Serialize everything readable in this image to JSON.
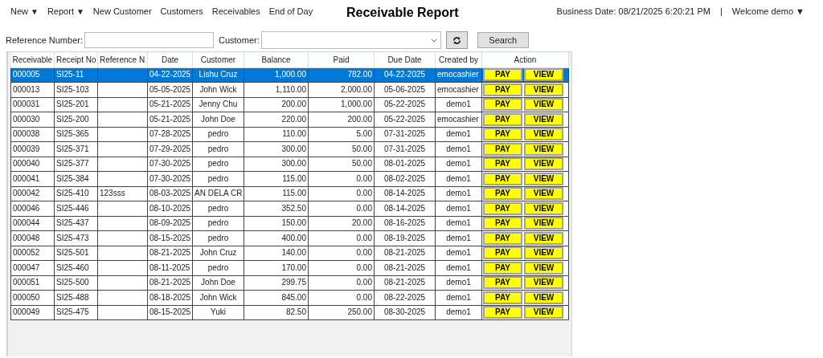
{
  "nav": [
    {
      "label": "New",
      "dropdown": true
    },
    {
      "label": "Report",
      "dropdown": true
    },
    {
      "label": "New Customer",
      "dropdown": false
    },
    {
      "label": "Customers",
      "dropdown": false
    },
    {
      "label": "Receivables",
      "dropdown": false
    },
    {
      "label": "End of Day",
      "dropdown": false
    }
  ],
  "dropdown_glyph": "▼",
  "title": "Receivable Report",
  "business_date": "Business Date: 08/21/2025 6:20:21 PM",
  "separator": "|",
  "user_menu": "Welcome demo",
  "filters": {
    "reference_label": "Reference Number:",
    "customer_label": "Customer:",
    "search_button": "Search"
  },
  "table": {
    "columns": [
      "Receivable",
      "Receipt No",
      "Reference N",
      "Date",
      "Customer",
      "Balance",
      "Paid",
      "Due Date",
      "Created by",
      "Action"
    ],
    "rows": [
      {
        "selected": true,
        "cells": [
          "000005",
          "SI25-11",
          "",
          "04-22-2025",
          "Lishu Cruz",
          "1,000.00",
          "782.00",
          "04-22-2025",
          "emocashier"
        ],
        "actions": [
          {
            "label": "PAY"
          },
          {
            "label": "VIEW"
          }
        ]
      },
      {
        "selected": false,
        "cells": [
          "000013",
          "SI25-103",
          "",
          "05-05-2025",
          "John Wick",
          "1,110.00",
          "2,000.00",
          "05-06-2025",
          "emocashier"
        ],
        "actions": [
          {
            "label": "PAY"
          },
          {
            "label": "VIEW"
          }
        ]
      },
      {
        "selected": false,
        "cells": [
          "000031",
          "SI25-201",
          "",
          "05-21-2025",
          "Jenny Chu",
          "200.00",
          "1,000.00",
          "05-22-2025",
          "demo1"
        ],
        "actions": [
          {
            "label": "PAY"
          },
          {
            "label": "VIEW"
          }
        ]
      },
      {
        "selected": false,
        "cells": [
          "000030",
          "SI25-200",
          "",
          "05-21-2025",
          "John Doe",
          "220.00",
          "200.00",
          "05-22-2025",
          "emocashier"
        ],
        "actions": [
          {
            "label": "PAY"
          },
          {
            "label": "VIEW"
          }
        ]
      },
      {
        "selected": false,
        "cells": [
          "000038",
          "SI25-365",
          "",
          "07-28-2025",
          "pedro",
          "110.00",
          "5.00",
          "07-31-2025",
          "demo1"
        ],
        "actions": [
          {
            "label": "PAY"
          },
          {
            "label": "VIEW"
          }
        ]
      },
      {
        "selected": false,
        "cells": [
          "000039",
          "SI25-371",
          "",
          "07-29-2025",
          "pedro",
          "300.00",
          "50.00",
          "07-31-2025",
          "demo1"
        ],
        "actions": [
          {
            "label": "PAY"
          },
          {
            "label": "VIEW"
          }
        ]
      },
      {
        "selected": false,
        "cells": [
          "000040",
          "SI25-377",
          "",
          "07-30-2025",
          "pedro",
          "300.00",
          "50.00",
          "08-01-2025",
          "demo1"
        ],
        "actions": [
          {
            "label": "PAY"
          },
          {
            "label": "VIEW"
          }
        ]
      },
      {
        "selected": false,
        "cells": [
          "000041",
          "SI25-384",
          "",
          "07-30-2025",
          "pedro",
          "115.00",
          "0.00",
          "08-02-2025",
          "demo1"
        ],
        "actions": [
          {
            "label": "PAY"
          },
          {
            "label": "VIEW"
          }
        ]
      },
      {
        "selected": false,
        "cells": [
          "000042",
          "SI25-410",
          "123sss",
          "08-03-2025",
          "AN DELA CR",
          "115.00",
          "0.00",
          "08-14-2025",
          "demo1"
        ],
        "actions": [
          {
            "label": "PAY"
          },
          {
            "label": "VIEW"
          }
        ]
      },
      {
        "selected": false,
        "cells": [
          "000046",
          "SI25-446",
          "",
          "08-10-2025",
          "pedro",
          "352.50",
          "0.00",
          "08-14-2025",
          "demo1"
        ],
        "actions": [
          {
            "label": "PAY"
          },
          {
            "label": "VIEW"
          }
        ]
      },
      {
        "selected": false,
        "cells": [
          "000044",
          "SI25-437",
          "",
          "08-09-2025",
          "pedro",
          "150.00",
          "20.00",
          "08-16-2025",
          "demo1"
        ],
        "actions": [
          {
            "label": "PAY"
          },
          {
            "label": "VIEW"
          }
        ]
      },
      {
        "selected": false,
        "cells": [
          "000048",
          "SI25-473",
          "",
          "08-15-2025",
          "pedro",
          "400.00",
          "0.00",
          "08-19-2025",
          "demo1"
        ],
        "actions": [
          {
            "label": "PAY"
          },
          {
            "label": "VIEW"
          }
        ]
      },
      {
        "selected": false,
        "cells": [
          "000052",
          "SI25-501",
          "",
          "08-21-2025",
          "John Cruz",
          "140.00",
          "0.00",
          "08-21-2025",
          "demo1"
        ],
        "actions": [
          {
            "label": "PAY"
          },
          {
            "label": "VIEW"
          }
        ]
      },
      {
        "selected": false,
        "cells": [
          "000047",
          "SI25-460",
          "",
          "08-11-2025",
          "pedro",
          "170.00",
          "0.00",
          "08-21-2025",
          "demo1"
        ],
        "actions": [
          {
            "label": "PAY"
          },
          {
            "label": "VIEW"
          }
        ]
      },
      {
        "selected": false,
        "cells": [
          "000051",
          "SI25-500",
          "",
          "08-21-2025",
          "John Doe",
          "299.75",
          "0.00",
          "08-21-2025",
          "demo1"
        ],
        "actions": [
          {
            "label": "PAY"
          },
          {
            "label": "VIEW"
          }
        ]
      },
      {
        "selected": false,
        "cells": [
          "000050",
          "SI25-488",
          "",
          "08-18-2025",
          "John Wick",
          "845.00",
          "0.00",
          "08-22-2025",
          "demo1"
        ],
        "actions": [
          {
            "label": "PAY"
          },
          {
            "label": "VIEW"
          }
        ]
      },
      {
        "selected": false,
        "cells": [
          "000049",
          "SI25-475",
          "",
          "08-15-2025",
          "Yuki",
          "82.50",
          "250.00",
          "08-30-2025",
          "demo1"
        ],
        "actions": [
          {
            "label": "PAY"
          },
          {
            "label": "VIEW"
          }
        ]
      }
    ]
  }
}
